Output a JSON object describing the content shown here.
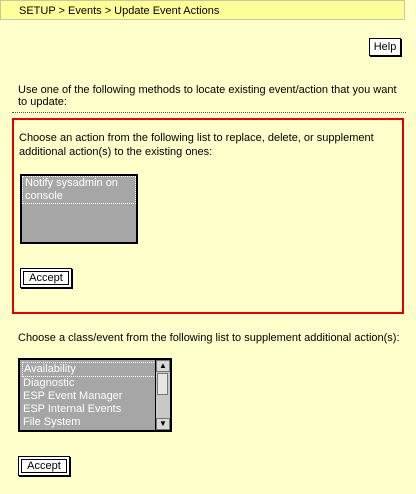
{
  "breadcrumb": "SETUP > Events > Update Event Actions",
  "help_label": "Help",
  "instruction": "Use one of the following methods to locate existing event/action that you want to update:",
  "action_panel": {
    "text": "Choose an action from the following list to replace, delete, or supplement additional action(s) to the existing ones:",
    "list_items": [
      "Notify sysadmin on console"
    ],
    "accept_label": "Accept"
  },
  "class_panel": {
    "text": "Choose a class/event from the following list to supplement additional action(s):",
    "list_items": [
      "Availability",
      "Diagnostic",
      "ESP Event Manager",
      "ESP Internal Events",
      "File System"
    ],
    "accept_label": "Accept"
  },
  "colors": {
    "background": "#FFFFCC",
    "highlight_border": "#E00000",
    "listbox_bg": "#A6A6A6"
  }
}
